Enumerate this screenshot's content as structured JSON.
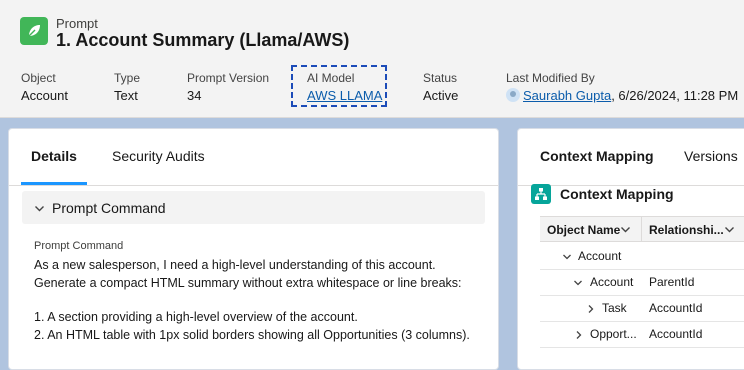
{
  "header": {
    "eyebrow": "Prompt",
    "title": "1. Account Summary (Llama/AWS)",
    "fields": {
      "object": {
        "label": "Object",
        "value": "Account"
      },
      "type": {
        "label": "Type",
        "value": "Text"
      },
      "version": {
        "label": "Prompt Version",
        "value": "34"
      },
      "model": {
        "label": "AI Model",
        "value": "AWS LLAMA"
      },
      "status": {
        "label": "Status",
        "value": "Active"
      },
      "modified": {
        "label": "Last Modified By",
        "user": "Saurabh Gupta",
        "date": ", 6/26/2024, 11:28 PM"
      }
    }
  },
  "left_panel": {
    "tabs": [
      "Details",
      "Security Audits"
    ],
    "section_title": "Prompt Command",
    "command_label": "Prompt Command",
    "command_lines": [
      "As a new salesperson, I need a high-level understanding of this account. Generate a compact HTML summary without extra whitespace or line breaks:",
      "1. A section providing a high-level overview of the account.",
      "2. An HTML table with 1px solid borders showing all Opportunities (3 columns)."
    ]
  },
  "right_panel": {
    "tabs": [
      "Context Mapping",
      "Versions"
    ],
    "title": "Context Mapping",
    "columns": [
      "Object Name",
      "Relationshi..."
    ],
    "rows": [
      {
        "name": "Account",
        "relationship": "",
        "indent": 0,
        "expanded": true
      },
      {
        "name": "Account",
        "relationship": "ParentId",
        "indent": 1,
        "expanded": true
      },
      {
        "name": "Task",
        "relationship": "AccountId",
        "indent": 2,
        "expanded": false
      },
      {
        "name": "Opport...",
        "relationship": "AccountId",
        "indent": 1,
        "expanded": false
      }
    ]
  },
  "colors": {
    "brand_green": "#41b658",
    "link_blue": "#0b5cab",
    "tab_accent": "#1b96ff",
    "context_teal": "#06a59a",
    "background": "#b0c4df"
  },
  "icons": [
    "prompt-leaf-icon",
    "chevron-down-icon",
    "chevron-right-icon",
    "context-hierarchy-icon",
    "avatar-icon"
  ]
}
